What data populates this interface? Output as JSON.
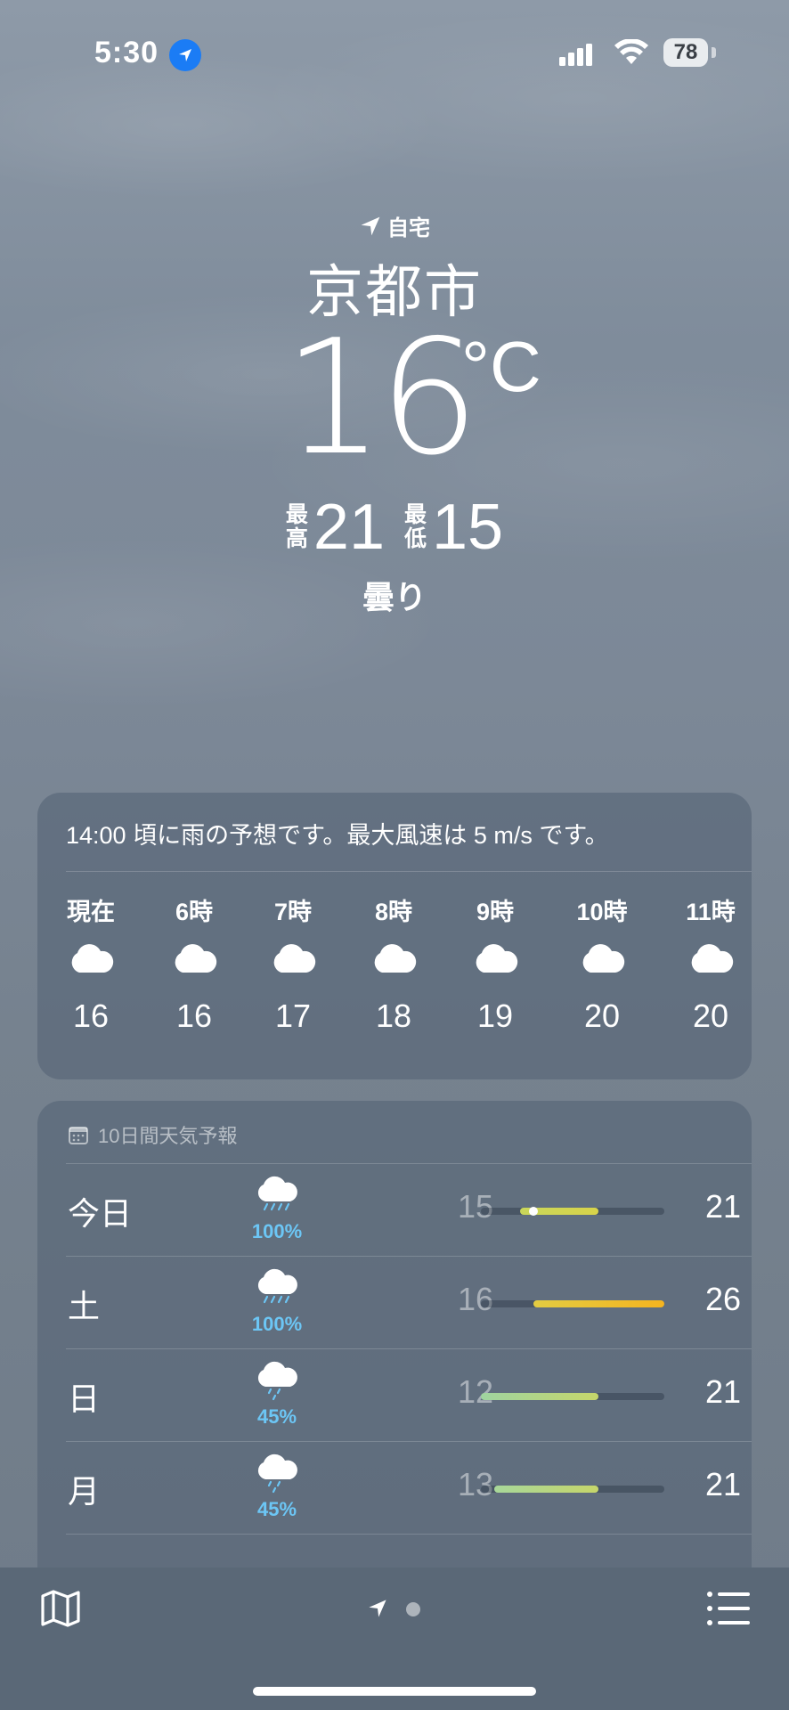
{
  "status_bar": {
    "time": "5:30",
    "battery": "78",
    "icons": [
      "location-arrow-icon",
      "cellular-signal-icon",
      "wifi-icon",
      "battery-icon"
    ]
  },
  "location": {
    "label": "自宅",
    "city": "京都市"
  },
  "current": {
    "temperature": "16",
    "unit": "°C",
    "high_label_1": "最",
    "high_label_2": "高",
    "high": "21",
    "low_label_1": "最",
    "low_label_2": "低",
    "low": "15",
    "condition": "曇り"
  },
  "hourly_card": {
    "summary": "14:00 頃に雨の予想です。最大風速は 5 m/s です。",
    "hours": [
      {
        "label": "現在",
        "icon": "cloud-icon",
        "temp": "16"
      },
      {
        "label": "6時",
        "icon": "cloud-icon",
        "temp": "16"
      },
      {
        "label": "7時",
        "icon": "cloud-icon",
        "temp": "17"
      },
      {
        "label": "8時",
        "icon": "cloud-icon",
        "temp": "18"
      },
      {
        "label": "9時",
        "icon": "cloud-icon",
        "temp": "19"
      },
      {
        "label": "10時",
        "icon": "cloud-icon",
        "temp": "20"
      },
      {
        "label": "11時",
        "icon": "cloud-icon",
        "temp": "20"
      }
    ]
  },
  "daily_card": {
    "title": "10日間天気予報",
    "range": {
      "min": 12,
      "max": 26
    },
    "days": [
      {
        "day": "今日",
        "icon": "heavy-rain-icon",
        "precip": "100%",
        "low": "15",
        "high": "21",
        "low_value": 15,
        "high_value": 21,
        "current_value": 16,
        "color_start": "#c9d65a",
        "color_end": "#d8d44a"
      },
      {
        "day": "土",
        "icon": "heavy-rain-icon",
        "precip": "100%",
        "low": "16",
        "high": "26",
        "low_value": 16,
        "high_value": 26,
        "color_start": "#e3cc42",
        "color_end": "#f5b41f"
      },
      {
        "day": "日",
        "icon": "rain-icon",
        "precip": "45%",
        "low": "12",
        "high": "21",
        "low_value": 12,
        "high_value": 21,
        "color_start": "#9fd4a0",
        "color_end": "#c6d66a"
      },
      {
        "day": "月",
        "icon": "rain-icon",
        "precip": "45%",
        "low": "13",
        "high": "21",
        "low_value": 13,
        "high_value": 21,
        "color_start": "#a8d79a",
        "color_end": "#c6d66a"
      }
    ]
  },
  "toolbar": {
    "icons": [
      "map-icon",
      "location-arrow-icon",
      "page-dot-icon",
      "list-icon"
    ]
  }
}
